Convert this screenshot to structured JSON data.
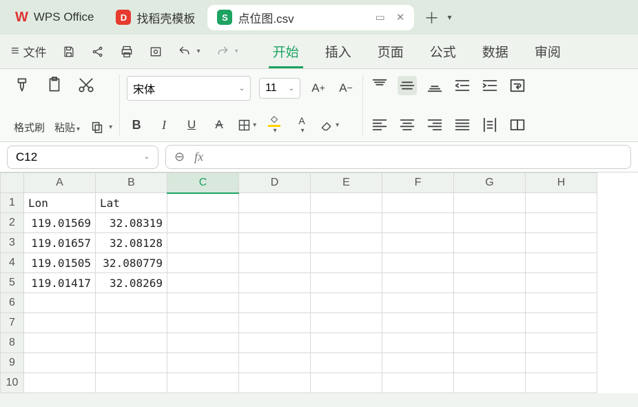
{
  "app_name": "WPS Office",
  "template_tab": "找稻壳模板",
  "doc": {
    "name": "点位图.csv"
  },
  "file_menu": "文件",
  "menu_tabs": [
    "开始",
    "插入",
    "页面",
    "公式",
    "数据",
    "审阅"
  ],
  "active_menu": "开始",
  "ribbon": {
    "format_painter": "格式刷",
    "paste": "粘贴",
    "font_name": "宋体",
    "font_size": "11"
  },
  "cell_ref": "C12",
  "fx_label": "fx",
  "columns": [
    "A",
    "B",
    "C",
    "D",
    "E",
    "F",
    "G",
    "H"
  ],
  "active_col": "C",
  "rows": [
    {
      "n": "1",
      "A": "Lon",
      "B": "Lat",
      "alignA": "left",
      "alignB": "left"
    },
    {
      "n": "2",
      "A": "119.01569",
      "B": "32.08319"
    },
    {
      "n": "3",
      "A": "119.01657",
      "B": "32.08128"
    },
    {
      "n": "4",
      "A": "119.01505",
      "B": "32.080779"
    },
    {
      "n": "5",
      "A": "119.01417",
      "B": "32.08269"
    },
    {
      "n": "6"
    },
    {
      "n": "7"
    },
    {
      "n": "8"
    },
    {
      "n": "9"
    },
    {
      "n": "10"
    }
  ]
}
